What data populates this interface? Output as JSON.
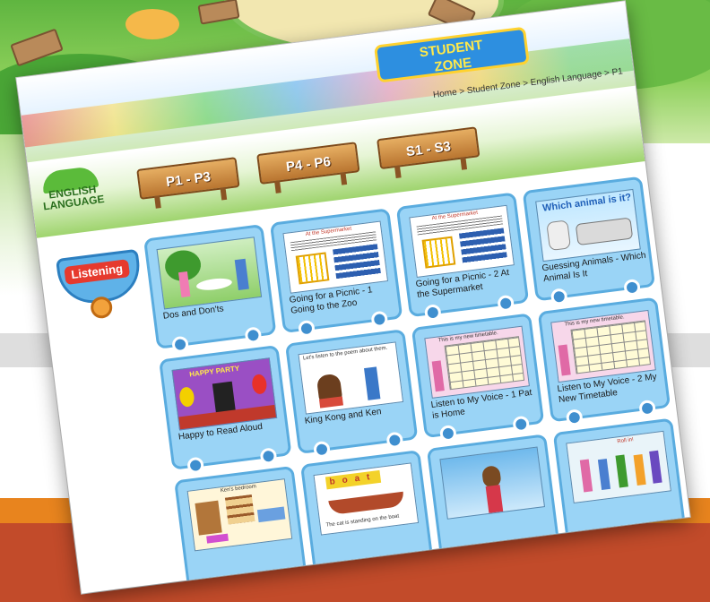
{
  "header": {
    "breadcrumb": [
      "Home",
      "Student Zone",
      "English Language",
      "P1"
    ],
    "separator": " > ",
    "zone_logo_line1": "STUDENT",
    "zone_logo_line2": "ZONE"
  },
  "subject_badge": "ENGLISH LANGUAGE",
  "level_tabs": [
    "P1 - P3",
    "P4 - P6",
    "S1 - S3"
  ],
  "category_label": "Listening",
  "thumb_texts": {
    "supermarket_heading": "At the Supermarket",
    "which_animal": "Which animal is it?",
    "happy_party": "HAPPY PARTY",
    "timetable_heading": "This is my new timetable.",
    "poem_prompt": "Let's listen to the poem about them.",
    "boat_letters": [
      "b",
      "o",
      "a",
      "t"
    ],
    "boat_caption": "The cat is standing on the boat",
    "bedroom_caption": "Ken's bedroom",
    "school_sign": "Roll in!"
  },
  "activities": [
    {
      "title": "Dos and Don'ts"
    },
    {
      "title": "Going for a Picnic - 1 Going to the Zoo"
    },
    {
      "title": "Going for a Picnic - 2 At the Supermarket"
    },
    {
      "title": "Guessing Animals - Which Animal Is It"
    },
    {
      "title": "Happy to Read Aloud"
    },
    {
      "title": "King Kong and Ken"
    },
    {
      "title": "Listen to My Voice - 1 Pat is Home"
    },
    {
      "title": "Listen to My Voice - 2 My New Timetable"
    }
  ],
  "colors": {
    "tile_bg": "#9ad4f6",
    "tile_border": "#5aacdf",
    "board_wood": "#c98a40",
    "band_orange": "#e8841e",
    "band_brown": "#c24b2a"
  }
}
